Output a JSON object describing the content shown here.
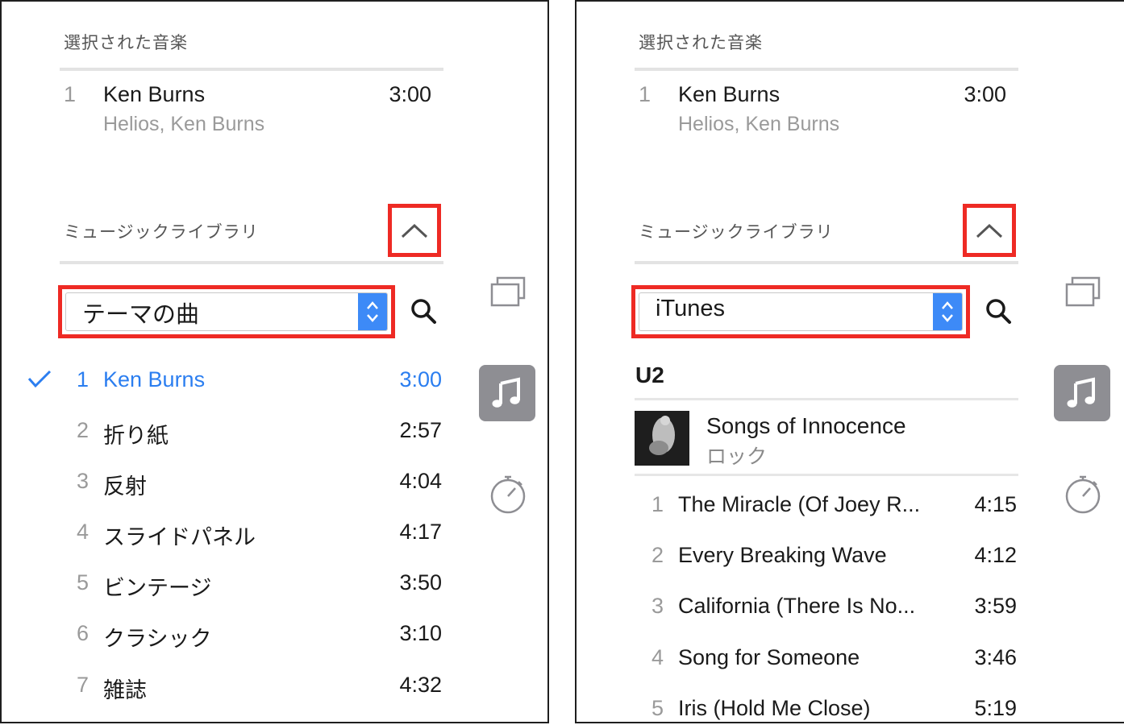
{
  "left": {
    "selected_section_title": "選択された音楽",
    "selected_track": {
      "num": "1",
      "title": "Ken Burns",
      "subtitle": "Helios, Ken Burns",
      "duration": "3:00"
    },
    "library_section_title": "ミュージックライブラリ",
    "source_select": {
      "value": "テーマの曲"
    },
    "tracks": [
      {
        "num": "1",
        "title": "Ken Burns",
        "duration": "3:00"
      },
      {
        "num": "2",
        "title": "折り紙",
        "duration": "2:57"
      },
      {
        "num": "3",
        "title": "反射",
        "duration": "4:04"
      },
      {
        "num": "4",
        "title": "スライドパネル",
        "duration": "4:17"
      },
      {
        "num": "5",
        "title": "ビンテージ",
        "duration": "3:50"
      },
      {
        "num": "6",
        "title": "クラシック",
        "duration": "3:10"
      },
      {
        "num": "7",
        "title": "雑誌",
        "duration": "4:32"
      }
    ],
    "active_track_index": 0
  },
  "right": {
    "selected_section_title": "選択された音楽",
    "selected_track": {
      "num": "1",
      "title": "Ken Burns",
      "subtitle": "Helios, Ken Burns",
      "duration": "3:00"
    },
    "library_section_title": "ミュージックライブラリ",
    "source_select": {
      "value": "iTunes"
    },
    "artist_group": "U2",
    "album": {
      "title": "Songs of Innocence",
      "genre": "ロック"
    },
    "tracks": [
      {
        "num": "1",
        "title": "The Miracle (Of Joey R...",
        "duration": "4:15"
      },
      {
        "num": "2",
        "title": "Every Breaking Wave",
        "duration": "4:12"
      },
      {
        "num": "3",
        "title": "California (There Is No...",
        "duration": "3:59"
      },
      {
        "num": "4",
        "title": "Song for Someone",
        "duration": "3:46"
      },
      {
        "num": "5",
        "title": "Iris (Hold Me Close)",
        "duration": "5:19"
      }
    ]
  },
  "icons": {
    "collapse": "chevron-up-icon",
    "search": "search-icon",
    "themes": "stacked-windows-icon",
    "music": "music-note-icon",
    "duration": "stopwatch-icon",
    "check": "checkmark-icon"
  },
  "colors": {
    "highlight_red": "#ee2a24",
    "accent_blue": "#2b7ef0",
    "stepper_blue": "#3d8af7",
    "music_tile_gray": "#8e8e93"
  }
}
